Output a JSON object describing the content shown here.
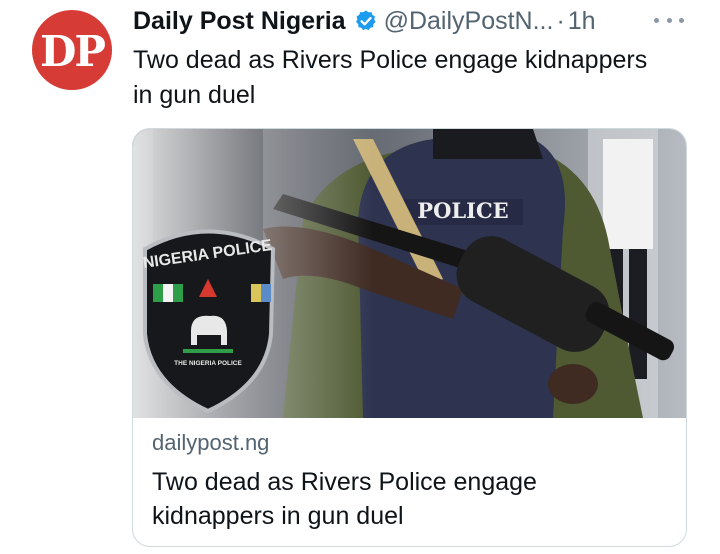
{
  "author": {
    "avatar_text": "DP",
    "display_name": "Daily Post Nigeria",
    "handle": "@DailyPostN...",
    "separator": "·",
    "time": "1h"
  },
  "tweet": {
    "text": "Two dead as Rivers Police engage kidnappers in gun duel"
  },
  "link_card": {
    "image": {
      "vest_text": "POLICE",
      "badge_top_text": "NIGERIA POLICE",
      "badge_bottom_text": "THE NIGERIA POLICE"
    },
    "domain": "dailypost.ng",
    "title": "Two dead as Rivers Police engage kidnappers in gun duel"
  },
  "icons": {
    "verified": "verified-badge-icon",
    "more": "more-options-icon"
  },
  "colors": {
    "brand_red": "#d63b35",
    "verified_blue": "#1d9bf0",
    "secondary_text": "#536471"
  }
}
